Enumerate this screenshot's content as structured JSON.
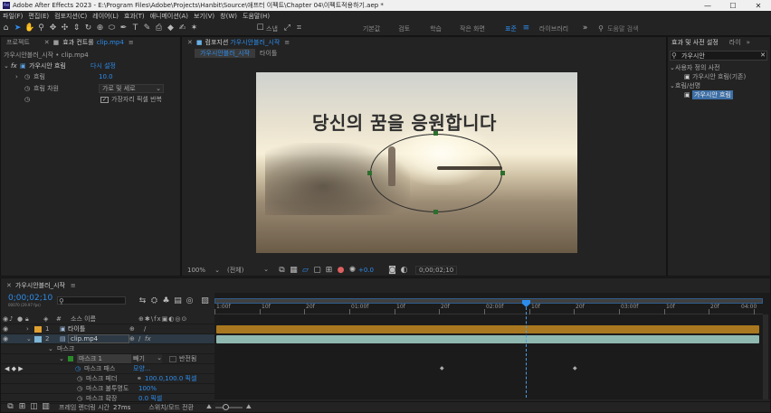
{
  "title_bar": {
    "app_icon_text": "Ae",
    "text": "Adobe After Effects 2023 - E:\\Program Files\\Adobe\\Projects\\Hanbit\\Source\\애프터 이펙트\\Chapter 04\\이펙트적용하기.aep *",
    "minimize": "—",
    "maximize": "☐",
    "close": "✕"
  },
  "menu": [
    "파일(F)",
    "편집(E)",
    "컴포지션(C)",
    "레이어(L)",
    "효과(T)",
    "애니메이션(A)",
    "보기(V)",
    "창(W)",
    "도움말(H)"
  ],
  "toolbar": {
    "snap_label": "스냅",
    "workspaces": [
      "기본값",
      "검토",
      "학습",
      "작은 화면",
      "표준",
      "라이브러리"
    ],
    "active_workspace": "표준",
    "overflow": "»",
    "search_placeholder": "도움말 검색"
  },
  "effect_controls": {
    "tabs": [
      "프로젝트",
      "효과 컨트롤",
      "clip.mp4"
    ],
    "subtitle": "가우시안블러_시작 • clip.mp4",
    "effect_name": "가우시안 흐림",
    "reset_label": "다시 설정",
    "props": [
      {
        "label": "흐림",
        "value": "10.0"
      },
      {
        "label": "흐림 차원",
        "value": "가로 및 세로"
      }
    ],
    "checkbox_label": "가장자리 픽셀 반복"
  },
  "composition": {
    "tab_prefix": "컴포지션",
    "tab_name": "가우시안블러_시작",
    "subtabs": [
      "가우시안블러_시작",
      "타이틀"
    ],
    "overlay_text": "당신의 꿈을 응원합니다",
    "footer": {
      "zoom": "100%",
      "resolution": "(전체)",
      "exposure": "+0.0",
      "timecode": "0;00;02;10"
    }
  },
  "effects_presets": {
    "tabs": [
      "효과 및 사전 설정",
      "라이"
    ],
    "search_value": "가우시안",
    "tree": [
      {
        "label": "사용자 정의 사전",
        "level": 0
      },
      {
        "label": "가우시안 흐림(기존)",
        "level": 1
      },
      {
        "label": "흐림/선명",
        "level": 0
      },
      {
        "label": "가우시안 흐림",
        "level": 1
      }
    ]
  },
  "timeline": {
    "tab_name": "가우시안블러_시작",
    "timecode": "0;00;02;10",
    "timecode_sub": "00070 (29.97 fps)",
    "header_cols": [
      "#",
      "소스 이름"
    ],
    "layers": [
      {
        "num": "1",
        "name": "타이틀",
        "color": "#e0a030"
      },
      {
        "num": "2",
        "name": "clip.mp4",
        "color": "#7fb6d6"
      }
    ],
    "mask_group": "마스크",
    "mask_name": "마스크 1",
    "mask_mode": "빼기",
    "mask_invert": "반전됨",
    "mask_props": [
      {
        "label": "마스크 패스",
        "value": "모양..."
      },
      {
        "label": "마스크 페더",
        "value": "100.0,100.0 픽셀"
      },
      {
        "label": "마스크 불투명도",
        "value": "100%"
      },
      {
        "label": "마스크 확장",
        "value": "0.0 픽셀"
      }
    ],
    "ruler_labels": [
      "1:00f",
      "10f",
      "20f",
      "01:00f",
      "10f",
      "20f",
      "02:00f",
      "10f",
      "20f",
      "03:00f",
      "10f",
      "20f",
      "04:00"
    ],
    "playhead_fraction": 0.578,
    "footer_render_label": "프레임 렌더링 시간",
    "footer_render_value": "27ms",
    "footer_toggle": "스위치/모드 전환"
  }
}
